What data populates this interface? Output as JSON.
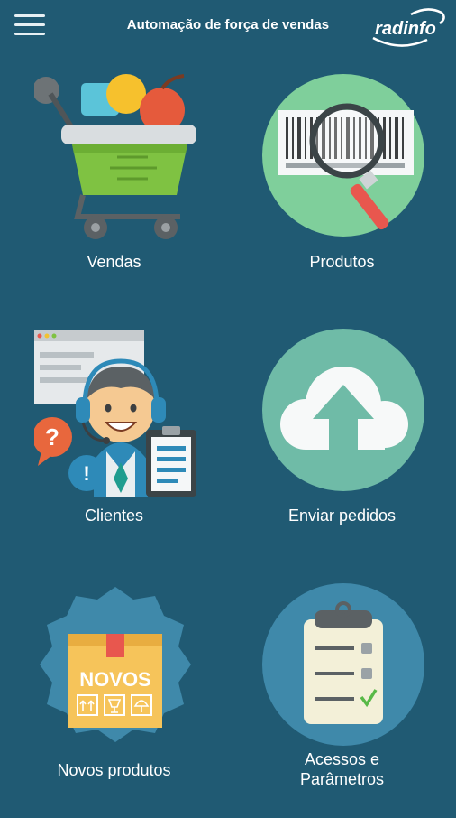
{
  "header": {
    "title": "Automação de força de vendas",
    "logo_text": "radinfo"
  },
  "menu": [
    {
      "id": "vendas",
      "label": "Vendas",
      "icon": "shopping-cart-icon"
    },
    {
      "id": "produtos",
      "label": "Produtos",
      "icon": "barcode-search-icon"
    },
    {
      "id": "clientes",
      "label": "Clientes",
      "icon": "customer-support-icon"
    },
    {
      "id": "enviar",
      "label": "Enviar pedidos",
      "icon": "cloud-upload-icon"
    },
    {
      "id": "novos",
      "label": "Novos produtos",
      "icon": "new-products-box-icon"
    },
    {
      "id": "acessos",
      "label": "Acessos e Parâmetros",
      "label_line1": "Acessos e",
      "label_line2": "Parâmetros",
      "icon": "clipboard-checklist-icon"
    }
  ],
  "box_text": "NOVOS",
  "colors": {
    "background": "#205a73",
    "text": "#ffffff",
    "green_circle": "#7fcf9b",
    "teal_circle": "#6fbba7",
    "blue_circle": "#3f89aa"
  }
}
